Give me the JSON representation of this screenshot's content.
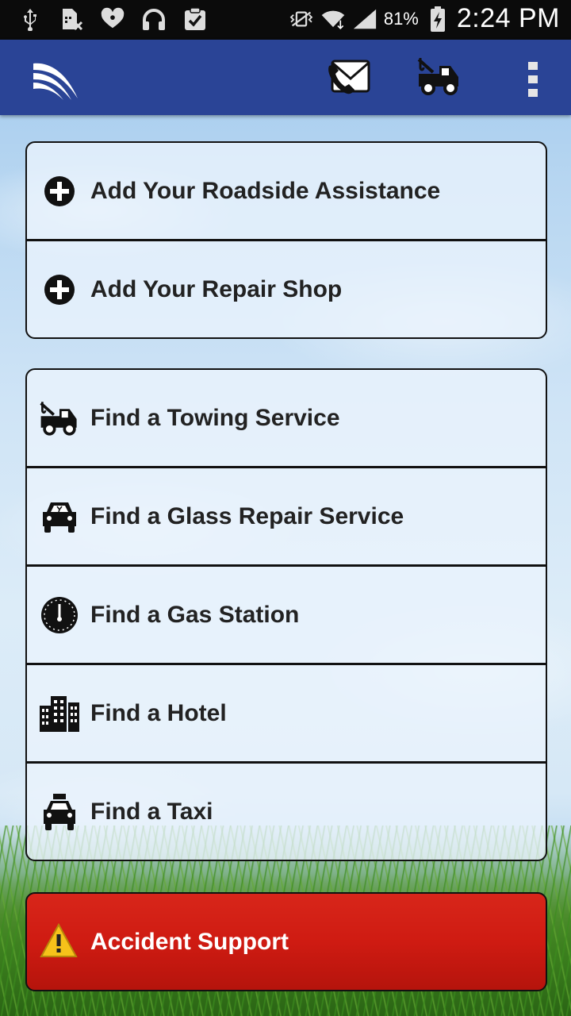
{
  "status_bar": {
    "icons": [
      "usb-icon",
      "sim-off-icon",
      "iheart-icon",
      "headphones-icon",
      "clipboard-check-icon",
      "vibrate-mute-icon",
      "wifi-icon",
      "signal-icon",
      "battery-charging-icon"
    ],
    "battery": "81%",
    "time": "2:24 PM"
  },
  "app_bar": {
    "logo": "roadside-logo-icon",
    "actions": [
      "call-icon",
      "tow-truck-icon",
      "more-options-icon"
    ],
    "color": "#2a4496"
  },
  "add_panel": {
    "items": [
      {
        "label": "Add Your Roadside Assistance",
        "icon": "plus-circle-icon"
      },
      {
        "label": "Add Your Repair Shop",
        "icon": "plus-circle-icon"
      }
    ]
  },
  "find_panel": {
    "items": [
      {
        "label": "Find a Towing Service",
        "icon": "tow-truck-icon"
      },
      {
        "label": "Find a Glass Repair Service",
        "icon": "broken-windshield-car-icon"
      },
      {
        "label": "Find a Gas Station",
        "icon": "fuel-gauge-icon"
      },
      {
        "label": "Find a Hotel",
        "icon": "buildings-icon"
      },
      {
        "label": "Find a Taxi",
        "icon": "taxi-icon"
      }
    ]
  },
  "accident": {
    "label": "Accident Support",
    "icon": "warning-icon",
    "color": "#d0201a"
  }
}
